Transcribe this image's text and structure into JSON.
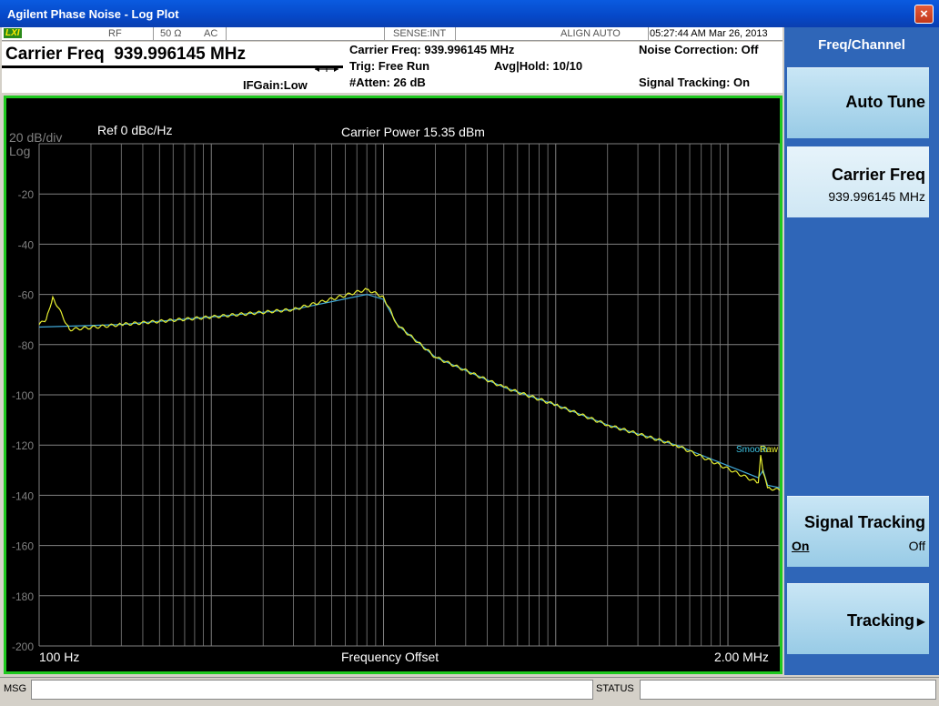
{
  "window": {
    "title": "Agilent Phase Noise - Log Plot",
    "close": "×"
  },
  "status": {
    "lxi": "LXI",
    "rf": "RF",
    "impedance": "50 Ω",
    "coupling": "AC",
    "sense": "SENSE:INT",
    "align": "ALIGN AUTO",
    "datetime": "05:27:44 AM Mar 26, 2013"
  },
  "header": {
    "carrier_freq_label": "Carrier Freq  939.996145 MHz",
    "ifgain": "IFGain:Low",
    "carrier_freq_info": "Carrier Freq: 939.996145 MHz",
    "trig": "Trig: Free Run",
    "atten": "#Atten: 26 dB",
    "avg_hold": "Avg|Hold: 10/10",
    "noise_correction": "Noise Correction: Off",
    "signal_tracking": "Signal Tracking: On"
  },
  "display": {
    "scale": "20 dB/div",
    "log": "Log",
    "ref": "Ref  0 dBc/Hz",
    "carrier_power": "Carrier Power 15.35 dBm",
    "x_start": "100 Hz",
    "x_label": "Frequency Offset",
    "x_stop": "2.00 MHz",
    "trace_labels": [
      "Smooth",
      "Raw"
    ]
  },
  "softkeys": {
    "header": "Freq/Channel",
    "auto_tune": "Auto Tune",
    "carrier_freq": "Carrier Freq",
    "carrier_freq_value": "939.996145 MHz",
    "signal_tracking": "Signal Tracking",
    "on": "On",
    "off": "Off",
    "tracking": "Tracking"
  },
  "footer": {
    "msg": "MSG",
    "status": "STATUS"
  },
  "colors": {
    "raw_trace": "#e8f030",
    "smooth_trace": "#40a8d8",
    "frame": "#1ec81e",
    "grid": "#808080"
  },
  "chart_data": {
    "type": "line",
    "x_scale": "log",
    "xlim": [
      100,
      2000000
    ],
    "ylim": [
      -200,
      0
    ],
    "y_ticks": [
      -20,
      -40,
      -60,
      -80,
      -100,
      -120,
      -140,
      -160,
      -180,
      -200
    ],
    "series": [
      {
        "name": "Raw",
        "x": [
          100,
          110,
          120,
          150,
          300,
          1000,
          3000,
          8000,
          10000,
          12000,
          20000,
          50000,
          100000,
          200000,
          500000,
          1500000,
          1550000,
          1600000,
          1700000,
          2000000
        ],
        "y": [
          -72,
          -70,
          -61,
          -74,
          -72,
          -69,
          -66,
          -58,
          -61,
          -72,
          -85,
          -97,
          -104,
          -112,
          -120,
          -135,
          -124,
          -131,
          -137,
          -138
        ]
      },
      {
        "name": "Smooth",
        "x": [
          100,
          300,
          1000,
          3000,
          8000,
          10000,
          12000,
          20000,
          50000,
          100000,
          200000,
          500000,
          1500000,
          1600000,
          1700000,
          2000000
        ],
        "y": [
          -73,
          -72,
          -69,
          -66,
          -60,
          -62,
          -72,
          -85,
          -97,
          -104,
          -112,
          -120,
          -133,
          -130,
          -136,
          -137
        ]
      }
    ]
  }
}
